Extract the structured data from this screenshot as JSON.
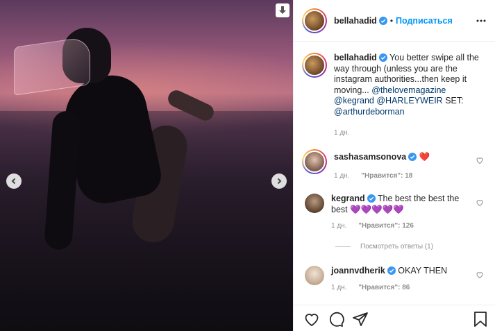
{
  "post": {
    "author": "bellahadid",
    "follow_label": "Подписаться",
    "dot": "•",
    "caption_text": "You better swipe all the way through (unless you are the instagram authorities...then keep it moving... ",
    "caption_mentions": [
      "@thelovemagazine",
      "@kegrand",
      "@HARLEYWEIR",
      "@arthurdeborman"
    ],
    "caption_set_label": "SET:",
    "caption_time": "1 дн."
  },
  "comments": [
    {
      "username": "sashasamsonova",
      "text": "❤️",
      "time": "1 дн.",
      "likes": "\"Нравится\": 18"
    },
    {
      "username": "kegrand",
      "text": "The best the best the best 💜💜💜💜💜",
      "time": "1 дн.",
      "likes": "\"Нравится\": 126"
    },
    {
      "username": "joannvdherik",
      "text": "OKAY THEN",
      "time": "1 дн.",
      "likes": "\"Нравится\": 86"
    }
  ],
  "view_replies": "Посмотреть ответы (1)",
  "icons": {
    "download": "download-icon",
    "prev": "chevron-left-icon",
    "next": "chevron-right-icon",
    "verified": "verified-badge-icon",
    "more": "more-options-icon",
    "like": "heart-icon",
    "comment": "comment-icon",
    "share": "share-icon",
    "save": "bookmark-icon"
  },
  "colors": {
    "link": "#00376b",
    "follow": "#0095f6",
    "verified": "#3897f0",
    "heart": "#ed4956"
  }
}
